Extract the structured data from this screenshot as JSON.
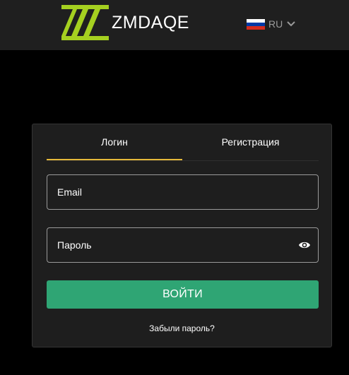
{
  "header": {
    "brand": "ZMDAQE",
    "logo_icon": "zmdaqe-logo-icon",
    "language": {
      "code": "RU",
      "flag_icon": "russia-flag-icon",
      "flag_colors": [
        "#ffffff",
        "#0039a6",
        "#d52b1e"
      ],
      "chevron_icon": "chevron-down-icon"
    }
  },
  "auth": {
    "tabs": [
      {
        "label": "Логин",
        "active": true
      },
      {
        "label": "Регистрация",
        "active": false
      }
    ],
    "email": {
      "placeholder": "Email",
      "value": ""
    },
    "password": {
      "placeholder": "Пароль",
      "value": "",
      "toggle_icon": "eye-icon"
    },
    "submit_label": "ВОЙТИ",
    "forgot_label": "Забыли пароль?"
  },
  "colors": {
    "accent": "#e6b93a",
    "primary_button": "#2fa574",
    "logo": "#a5d020"
  }
}
